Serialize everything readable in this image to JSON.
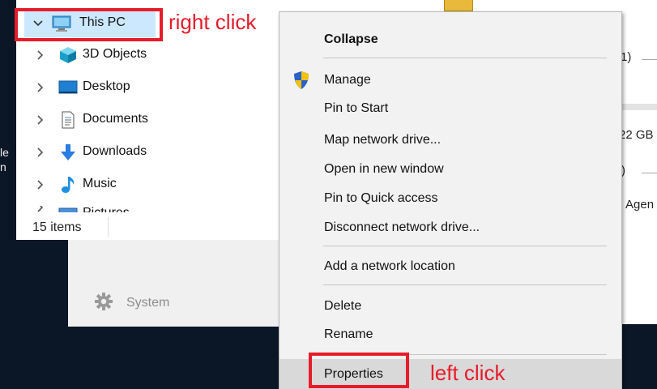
{
  "explorer": {
    "tree": [
      {
        "label": "This PC",
        "icon": "monitor-icon",
        "expanded": true,
        "selected": true
      },
      {
        "label": "3D Objects",
        "icon": "3d-cube-icon"
      },
      {
        "label": "Desktop",
        "icon": "desktop-icon"
      },
      {
        "label": "Documents",
        "icon": "document-icon"
      },
      {
        "label": "Downloads",
        "icon": "download-arrow-icon"
      },
      {
        "label": "Music",
        "icon": "music-note-icon"
      },
      {
        "label": "Pictures",
        "icon": "pictures-icon"
      }
    ],
    "status": "15 items"
  },
  "settings": {
    "system_label": "System"
  },
  "background_right": {
    "paren_1": "1)",
    "size_text": "22 GB",
    "paren_2": ")",
    "agent_text": "Agen"
  },
  "edge_text": {
    "line1": "le",
    "line2": "n"
  },
  "annotations": {
    "right_click": "right click",
    "left_click": "left click",
    "color": "#e61c2a"
  },
  "context_menu": {
    "items": [
      {
        "label": "Collapse",
        "bold": true
      },
      {
        "label": "Manage",
        "icon": "uac-shield-icon"
      },
      {
        "label": "Pin to Start"
      },
      {
        "label": "Map network drive..."
      },
      {
        "label": "Open in new window"
      },
      {
        "label": "Pin to Quick access"
      },
      {
        "label": "Disconnect network drive..."
      },
      {
        "label": "Add a network location"
      },
      {
        "label": "Delete"
      },
      {
        "label": "Rename"
      },
      {
        "label": "Properties",
        "hovered": true
      }
    ]
  }
}
